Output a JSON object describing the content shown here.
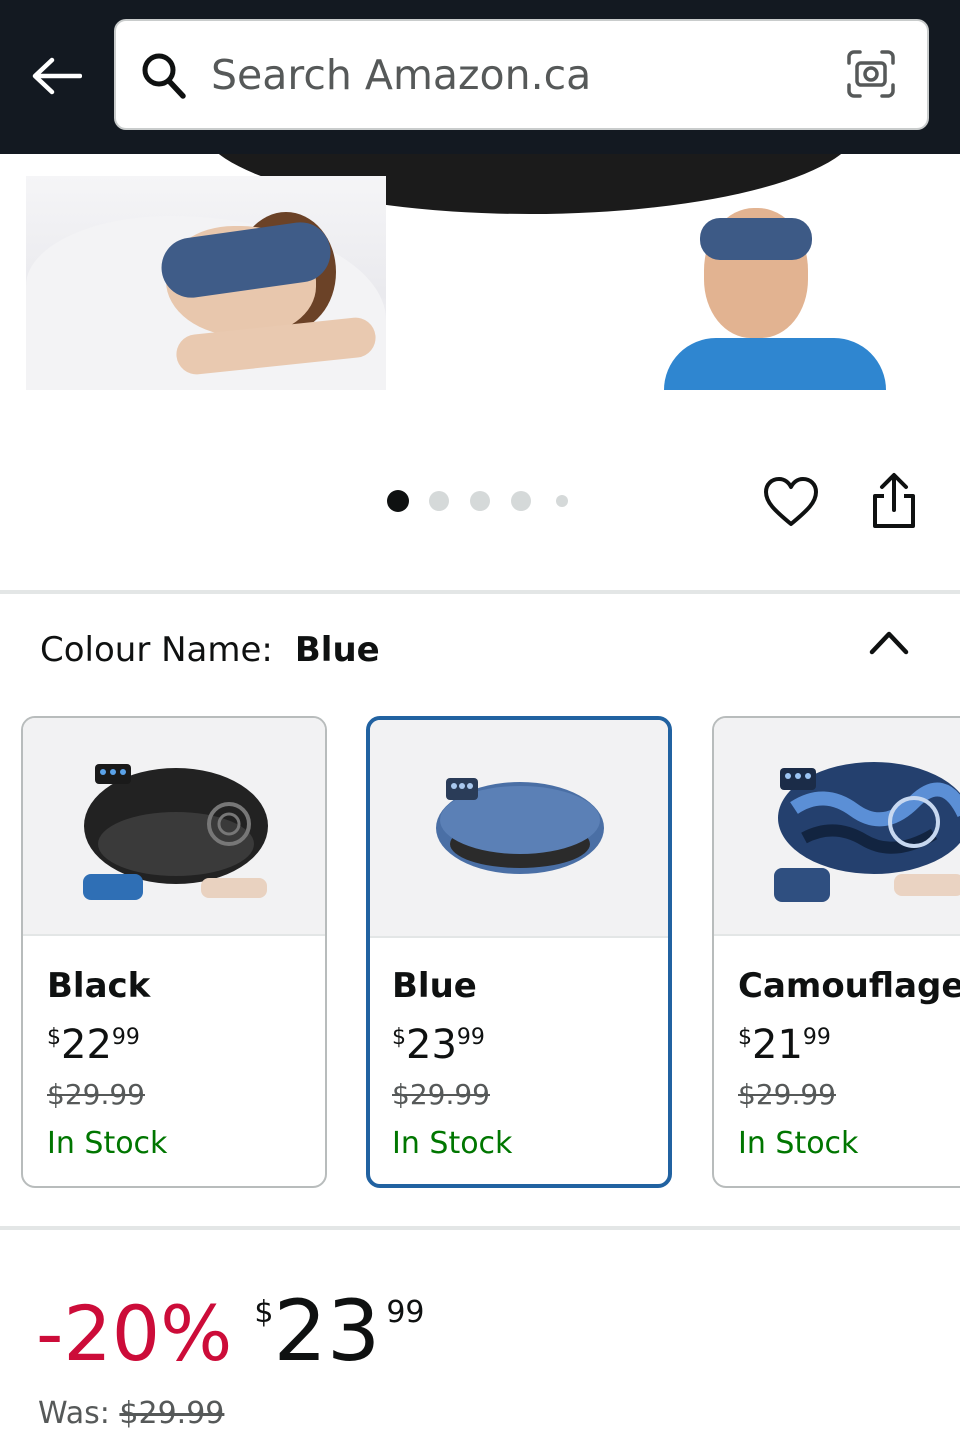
{
  "header": {
    "search_placeholder": "Search Amazon.ca",
    "background_color": "#131921"
  },
  "gallery": {
    "dot_count": 5,
    "active_dot_index": 0
  },
  "colour": {
    "label": "Colour Name:",
    "selected": "Blue"
  },
  "variants": [
    {
      "name": "Black",
      "currency": "$",
      "price_whole": "22",
      "price_fraction": "99",
      "was": "$29.99",
      "stock": "In Stock"
    },
    {
      "name": "Blue",
      "currency": "$",
      "price_whole": "23",
      "price_fraction": "99",
      "was": "$29.99",
      "stock": "In Stock",
      "selected": true
    },
    {
      "name": "Camouflage",
      "currency": "$",
      "price_whole": "21",
      "price_fraction": "99",
      "was": "$29.99",
      "stock": "In Stock"
    }
  ],
  "price": {
    "discount": "-20%",
    "currency": "$",
    "whole": "23",
    "fraction": "99",
    "was_label": "Was:",
    "was_value": "$29.99"
  },
  "colors": {
    "accent_blue": "#2162a1",
    "discount_red": "#cc0c39",
    "in_stock_green": "#007600"
  }
}
